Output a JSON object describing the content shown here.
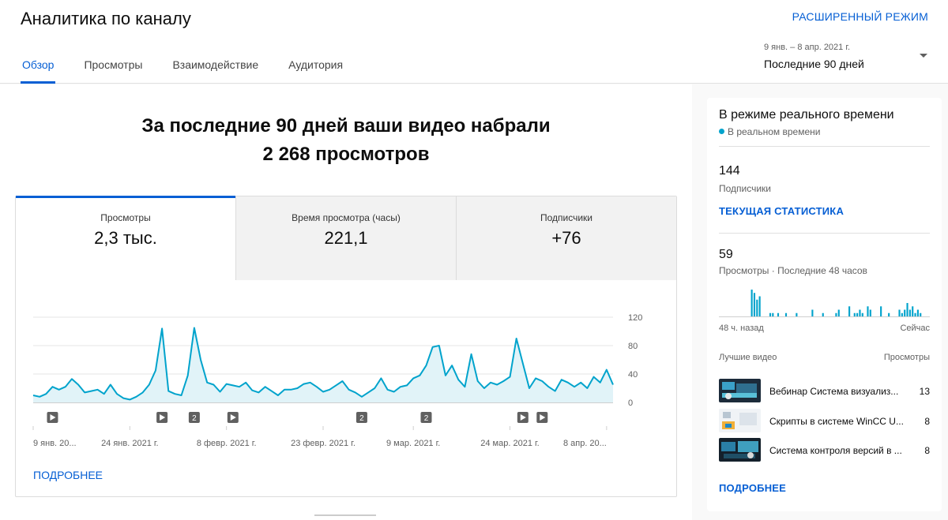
{
  "header": {
    "title": "Аналитика по каналу",
    "advanced_mode": "РАСШИРЕННЫЙ РЕЖИМ",
    "tabs": [
      {
        "label": "Обзор",
        "active": true
      },
      {
        "label": "Просмотры",
        "active": false
      },
      {
        "label": "Взаимодействие",
        "active": false
      },
      {
        "label": "Аудитория",
        "active": false
      }
    ],
    "date_range": {
      "dates": "9 янв. – 8 апр. 2021 г.",
      "label": "Последние 90 дней"
    }
  },
  "main": {
    "headline_line1": "За последние 90 дней ваши видео набрали",
    "headline_line2": "2 268 просмотров",
    "metrics": [
      {
        "label": "Просмотры",
        "value": "2,3 тыс.",
        "active": true
      },
      {
        "label": "Время просмотра (часы)",
        "value": "221,1",
        "active": false
      },
      {
        "label": "Подписчики",
        "value": "+76",
        "active": false
      }
    ],
    "more_link": "ПОДРОБНЕЕ"
  },
  "chart_data": {
    "type": "area",
    "series": [
      {
        "values": [
          10,
          8,
          12,
          22,
          18,
          22,
          33,
          25,
          14,
          16,
          18,
          12,
          25,
          12,
          6,
          4,
          8,
          14,
          25,
          45,
          104,
          16,
          12,
          10,
          38,
          105,
          60,
          28,
          25,
          15,
          26,
          24,
          22,
          28,
          17,
          14,
          22,
          16,
          10,
          18,
          18,
          20,
          26,
          28,
          22,
          15,
          18,
          24,
          30,
          18,
          14,
          8,
          14,
          20,
          34,
          18,
          15,
          22,
          24,
          34,
          38,
          52,
          78,
          80,
          38,
          52,
          32,
          22,
          68,
          30,
          20,
          28,
          25,
          30,
          36,
          90,
          55,
          20,
          34,
          30,
          22,
          16,
          32,
          28,
          22,
          28,
          20,
          36,
          28,
          46,
          25
        ]
      }
    ],
    "color": "#00a3cc",
    "fill_color": "#e1f3f8",
    "ylim": [
      0,
      120
    ],
    "yticks": [
      "120",
      "80",
      "40",
      "0"
    ],
    "xticks": [
      "9 янв. 20...",
      "24 янв. 2021 г.",
      "8 февр. 2021 г.",
      "23 февр. 2021 г.",
      "9 мар. 2021 г.",
      "24 мар. 2021 г.",
      "8 апр. 20..."
    ],
    "markers": [
      {
        "day": 3,
        "kind": "play",
        "label": ""
      },
      {
        "day": 20,
        "kind": "play",
        "label": ""
      },
      {
        "day": 25,
        "kind": "count",
        "label": "2"
      },
      {
        "day": 31,
        "kind": "play",
        "label": ""
      },
      {
        "day": 51,
        "kind": "count",
        "label": "2"
      },
      {
        "day": 61,
        "kind": "count",
        "label": "2"
      },
      {
        "day": 76,
        "kind": "play",
        "label": ""
      },
      {
        "day": 79,
        "kind": "play",
        "label": ""
      }
    ]
  },
  "realtime": {
    "title": "В режиме реального времени",
    "live_label": "В реальном времени",
    "subscribers_count": "144",
    "subscribers_label": "Подписчики",
    "current_stats_link": "ТЕКУЩАЯ СТАТИСТИКА",
    "views_count": "59",
    "views_label": "Просмотры · Последние 48 часов",
    "hourly_views": [
      0,
      0,
      0,
      0,
      0,
      0,
      0,
      0,
      0,
      0,
      0,
      0,
      8,
      7,
      5,
      6,
      0,
      0,
      0,
      1,
      1,
      0,
      1,
      0,
      0,
      1,
      0,
      0,
      0,
      1,
      0,
      0,
      0,
      0,
      0,
      2,
      0,
      0,
      0,
      1,
      0,
      0,
      0,
      0,
      1,
      2,
      0,
      0,
      0,
      3,
      0,
      1,
      1,
      2,
      1,
      0,
      3,
      2,
      0,
      0,
      0,
      3,
      0,
      0,
      1,
      0,
      0,
      0,
      2,
      1,
      2,
      4,
      2,
      3,
      1,
      2,
      1,
      0,
      0,
      0
    ],
    "axis_left": "48 ч. назад",
    "axis_right": "Сейчас",
    "top_videos_label": "Лучшие видео",
    "top_views_label": "Просмотры",
    "videos": [
      {
        "title": "Вебинар Система визуализ...",
        "views": "13",
        "thumb_icon": "webinar-thumbnail"
      },
      {
        "title": "Скрипты в системе WinCC U...",
        "views": "8",
        "thumb_icon": "scripts-thumbnail"
      },
      {
        "title": "Система контроля версий в ...",
        "views": "8",
        "thumb_icon": "version-control-thumbnail"
      }
    ],
    "more_link": "ПОДРОБНЕЕ"
  }
}
